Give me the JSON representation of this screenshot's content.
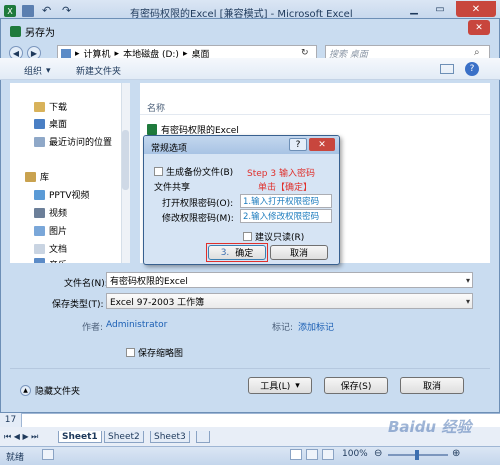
{
  "excel": {
    "title": "有密码权限的Excel  [兼容模式] - Microsoft Excel",
    "row_number": "17",
    "sheets": [
      "Sheet1",
      "Sheet2",
      "Sheet3"
    ],
    "status": "就绪",
    "zoom": "100%",
    "watermark": "Baidu 经验"
  },
  "save_as": {
    "title": "另存为",
    "breadcrumb": [
      "计算机",
      "本地磁盘 (D:)",
      "桌面"
    ],
    "search_placeholder": "搜索 桌面",
    "organize": "组织",
    "new_folder": "新建文件夹",
    "nav_items": [
      "下载",
      "桌面",
      "最近访问的位置",
      "库",
      "PPTV视频",
      "视频",
      "图片",
      "文档",
      "音乐"
    ],
    "column_name": "名称",
    "file_item": "有密码权限的Excel",
    "filename_label": "文件名(N):",
    "filename_value": "有密码权限的Excel",
    "filetype_label": "保存类型(T):",
    "filetype_value": "Excel 97-2003 工作簿",
    "author_label": "作者:",
    "author_value": "Administrator",
    "tags_label": "标记:",
    "tags_value": "添加标记",
    "thumbnail_label": "保存缩略图",
    "hide_folders": "隐藏文件夹",
    "tools": "工具(L)",
    "save": "保存(S)",
    "cancel": "取消"
  },
  "general": {
    "title": "常规选项",
    "help": "?",
    "backup": "生成备份文件(B)",
    "sharing": "文件共享",
    "open_pwd_label": "打开权限密码(O):",
    "modify_pwd_label": "修改权限密码(M):",
    "readonly": "建议只读(R)",
    "ok": "确定",
    "cancel": "取消",
    "annotations": {
      "step": "Step 3 输入密码",
      "click": "单击【确定】",
      "open_note": "1.输入打开权限密码",
      "modify_note": "2.输入修改权限密码",
      "ok_prefix": "3."
    }
  }
}
